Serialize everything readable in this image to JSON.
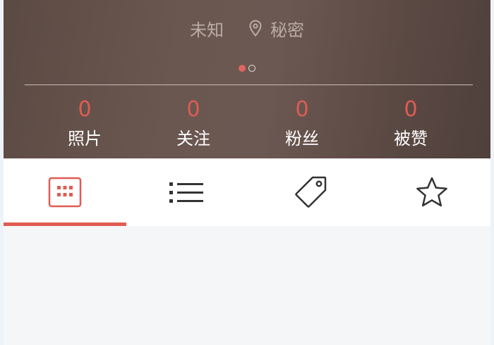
{
  "profile": {
    "gender": "未知",
    "location": "秘密",
    "location_icon": "location-pin-icon"
  },
  "pager": {
    "count": 2,
    "active_index": 0
  },
  "stats": [
    {
      "value": "0",
      "label": "照片"
    },
    {
      "value": "0",
      "label": "关注"
    },
    {
      "value": "0",
      "label": "粉丝"
    },
    {
      "value": "0",
      "label": "被赞"
    }
  ],
  "tabs": [
    {
      "icon": "grid-icon",
      "active": true
    },
    {
      "icon": "list-icon",
      "active": false
    },
    {
      "icon": "tag-icon",
      "active": false
    },
    {
      "icon": "star-icon",
      "active": false
    }
  ],
  "colors": {
    "accent": "#e05c52",
    "icon": "#333333",
    "header_text": "#b9aca6"
  }
}
